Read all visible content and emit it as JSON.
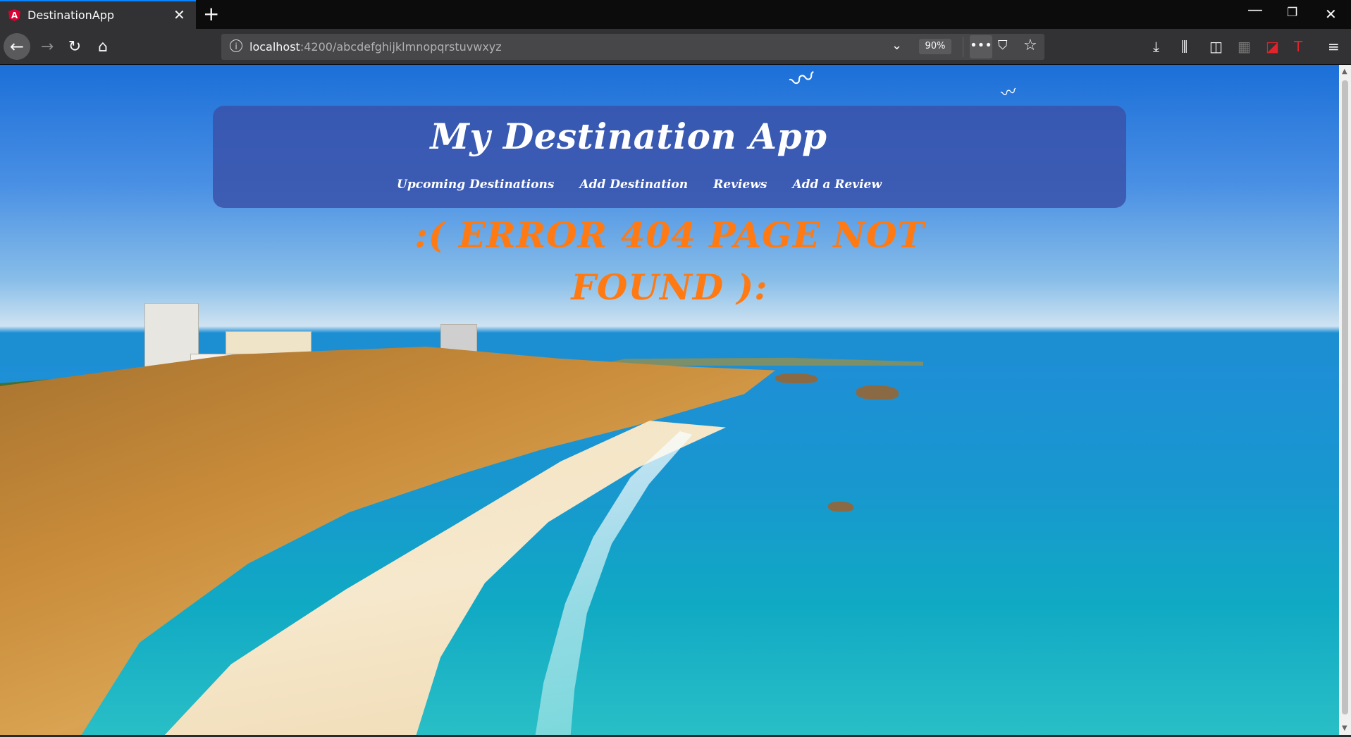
{
  "browser": {
    "tab": {
      "title": "DestinationApp",
      "favicon": "A"
    },
    "url": {
      "host": "localhost",
      "path": ":4200/abcdefghijklmnopqrstuvwxyz"
    },
    "zoom": "90%"
  },
  "app": {
    "title": "My Destination App",
    "nav": [
      {
        "label": "Upcoming Destinations"
      },
      {
        "label": "Add Destination"
      },
      {
        "label": "Reviews"
      },
      {
        "label": "Add a Review"
      }
    ],
    "error_line1": ":( ERROR 404 PAGE NOT",
    "error_line2": "FOUND ):"
  },
  "colors": {
    "header_bg": "#3a52aa",
    "error_text": "#ff7a12",
    "tab_accent": "#0a84ff"
  }
}
